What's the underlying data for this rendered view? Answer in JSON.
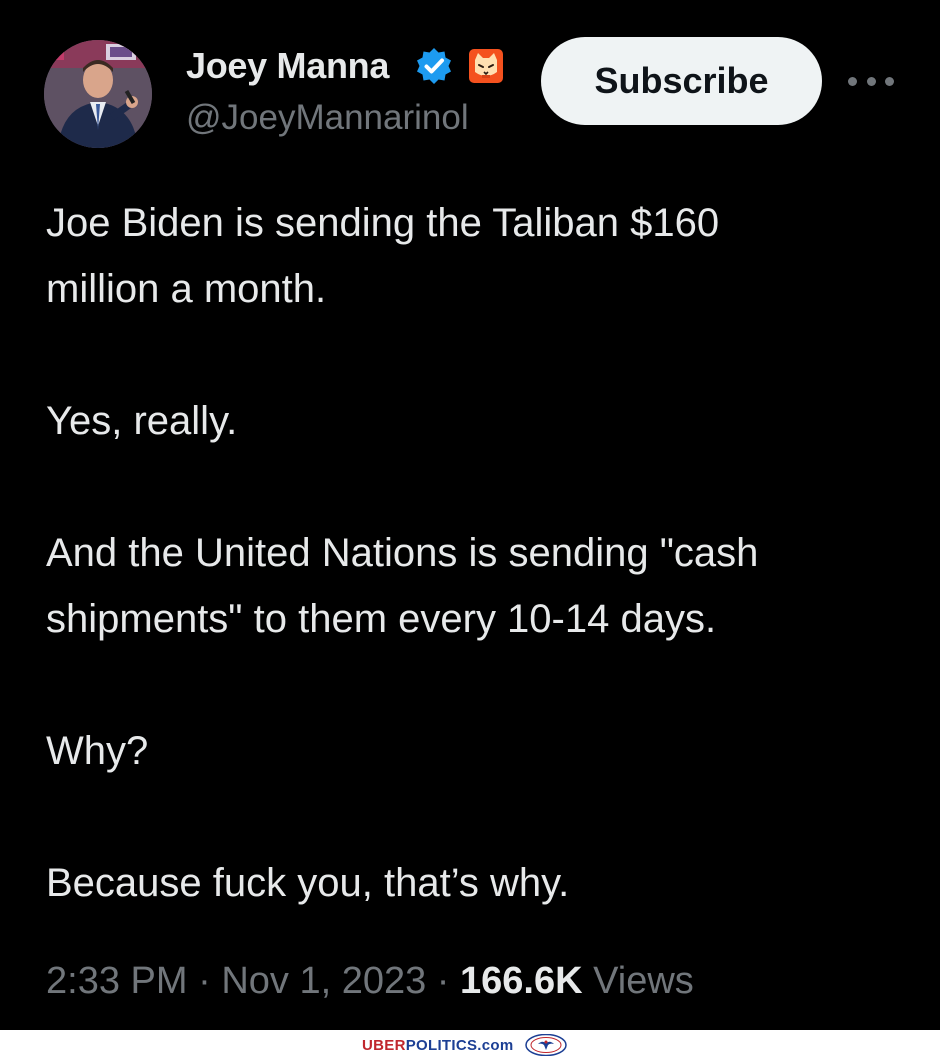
{
  "author": {
    "display_name": "Joey Manna",
    "handle": "@JoeyMannarinol",
    "avatar_icon": "profile-photo",
    "verified_icon": "verified-badge-icon",
    "affiliation_icon": "cat-emoji-icon"
  },
  "actions": {
    "subscribe_label": "Subscribe",
    "more_icon": "more-horizontal-icon"
  },
  "tweet": {
    "lines": [
      "Joe Biden is sending the Taliban $160",
      "million a month.",
      "Yes, really.",
      "And the United Nations is sending \"cash",
      "shipments\" to them every 10-14 days.",
      "Why?",
      "Because fuck you, that’s why."
    ]
  },
  "meta": {
    "time": "2:33 PM",
    "separator": "·",
    "date": "Nov 1, 2023",
    "views_count": "166.6K",
    "views_label": "Views"
  },
  "watermark": {
    "part1": "UBER",
    "part2": "POLITICS.com",
    "logo_icon": "eagle-seal-icon"
  },
  "colors": {
    "background": "#000000",
    "text_primary": "#e7e9ea",
    "text_secondary": "#71767b",
    "verified_blue": "#1d9bf0",
    "button_bg": "#eff3f4",
    "watermark_red": "#c0272d",
    "watermark_blue": "#1c3f94"
  }
}
